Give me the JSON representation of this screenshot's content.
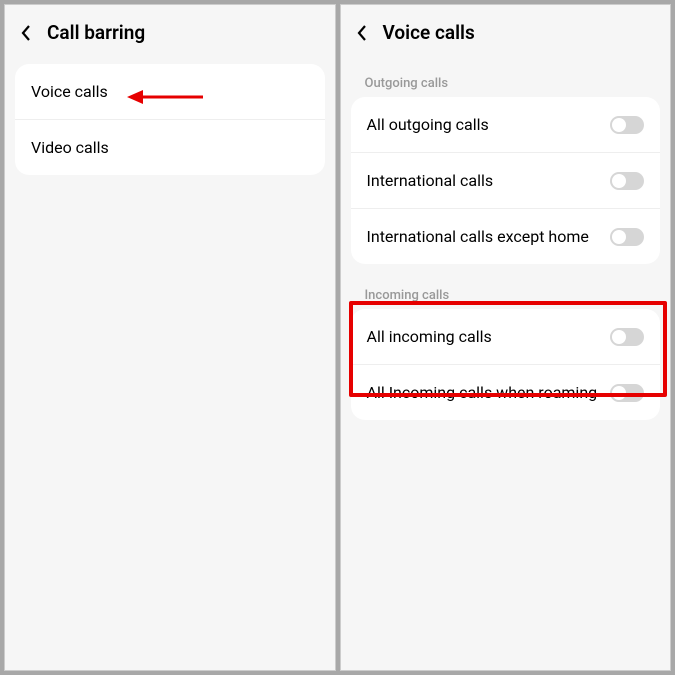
{
  "left": {
    "header": {
      "title": "Call barring"
    },
    "items": [
      {
        "label": "Voice calls"
      },
      {
        "label": "Video calls"
      }
    ]
  },
  "right": {
    "header": {
      "title": "Voice calls"
    },
    "sections": [
      {
        "label": "Outgoing calls",
        "items": [
          {
            "label": "All outgoing calls",
            "toggle": false
          },
          {
            "label": "International calls",
            "toggle": false
          },
          {
            "label": "International calls except home",
            "toggle": false
          }
        ]
      },
      {
        "label": "Incoming calls",
        "items": [
          {
            "label": "All incoming calls",
            "toggle": false
          },
          {
            "label": "All Incoming calls when roaming",
            "toggle": false
          }
        ]
      }
    ]
  },
  "annotation": {
    "highlight_color": "#e60000"
  }
}
